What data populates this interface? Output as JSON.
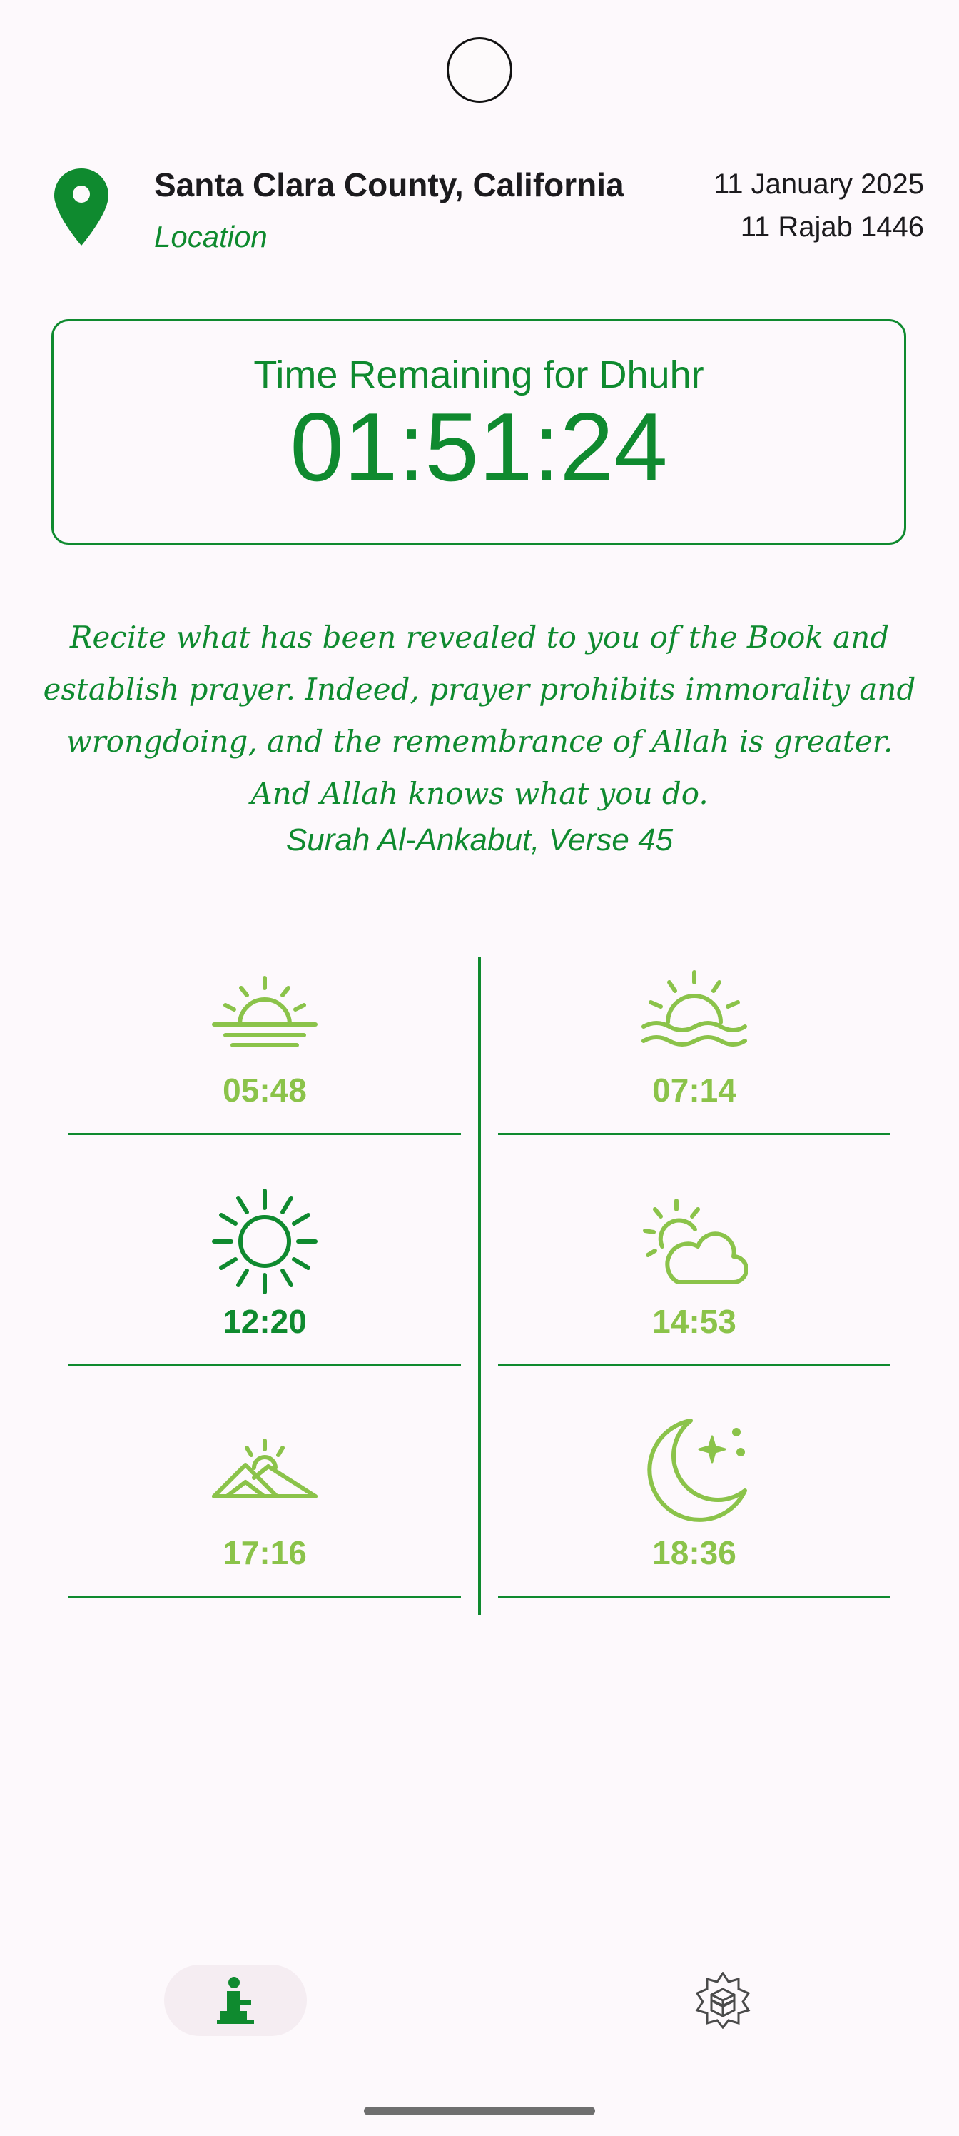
{
  "header": {
    "location_title": "Santa Clara County, California",
    "location_subtitle": "Location",
    "gregorian_date": "11 January 2025",
    "hijri_date": "11 Rajab 1446"
  },
  "countdown": {
    "label": "Time Remaining for Dhuhr",
    "time": "01:51:24"
  },
  "verse": {
    "text": "Recite what has been revealed to you of the Book and establish prayer. Indeed, prayer prohibits immorality and wrongdoing, and the remembrance of Allah is greater. And Allah knows what you do.",
    "source": "Surah Al-Ankabut, Verse 45"
  },
  "prayer_times": [
    {
      "time": "05:48",
      "icon": "sunrise-horizon-icon",
      "highlighted": false
    },
    {
      "time": "07:14",
      "icon": "sun-over-water-icon",
      "highlighted": false
    },
    {
      "time": "12:20",
      "icon": "sun-icon",
      "highlighted": true
    },
    {
      "time": "14:53",
      "icon": "sun-behind-cloud-icon",
      "highlighted": false
    },
    {
      "time": "17:16",
      "icon": "sunset-mountains-icon",
      "highlighted": false
    },
    {
      "time": "18:36",
      "icon": "crescent-moon-star-icon",
      "highlighted": false
    }
  ],
  "bottom_nav": {
    "items": [
      {
        "icon": "person-praying-icon",
        "selected": true
      },
      {
        "icon": "kaaba-compass-icon",
        "selected": false
      }
    ]
  },
  "colors": {
    "primary_green": "#0f8a2f",
    "light_green": "#8bc34a",
    "background": "#fdf9fc",
    "text_dark": "#1c1b1e"
  }
}
